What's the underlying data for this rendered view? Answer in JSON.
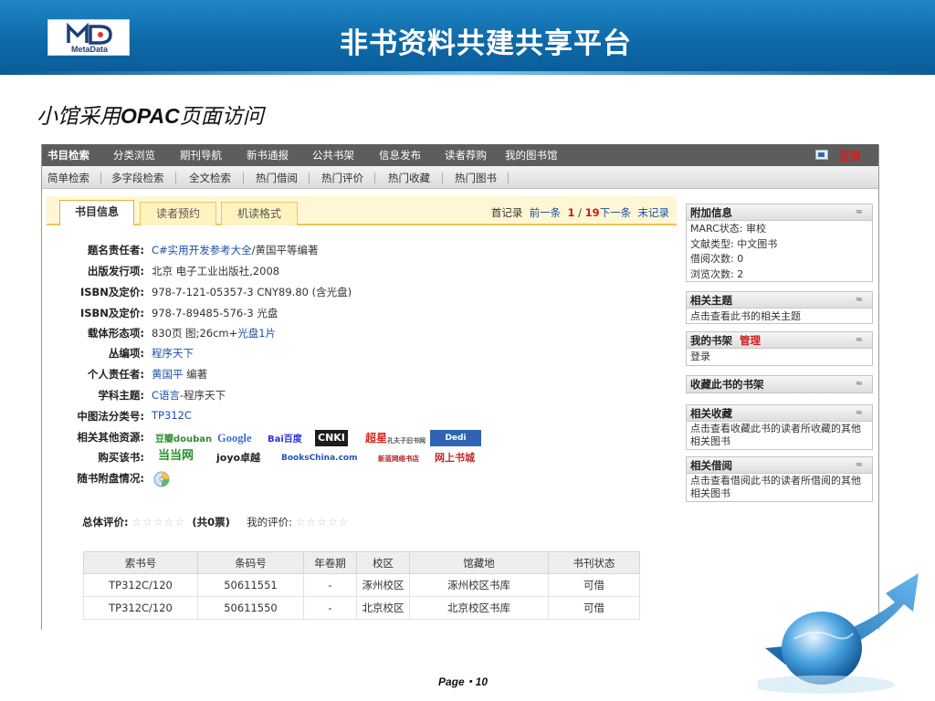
{
  "slide": {
    "title": "非书资料共建共享平台",
    "logo_text": "MetaData",
    "subtitle_pre": "小馆采用",
    "subtitle_bold": "OPAC",
    "subtitle_post": "页面访问",
    "page_label": "Page・10"
  },
  "nav_main": {
    "items": [
      "书目检索",
      "分类浏览",
      "期刊导航",
      "新书通报",
      "公共书架",
      "信息发布",
      "读者荐购",
      "我的图书馆"
    ],
    "login": "登录"
  },
  "nav_sub": {
    "items": [
      "简单检索",
      "多字段检索",
      "全文检索",
      "热门借阅",
      "热门评价",
      "热门收藏",
      "热门图书"
    ]
  },
  "tabs": [
    "书目信息",
    "读者预约",
    "机读格式"
  ],
  "pager": {
    "first": "首记录",
    "prev": "前一条",
    "current": "1",
    "separator": "/",
    "total": "19",
    "next": "下一条",
    "last": "末记录"
  },
  "fields": {
    "title_resp": {
      "label": "题名责任者:",
      "link": "C#实用开发参考大全",
      "rest": "/黄国平等编著"
    },
    "publisher": {
      "label": "出版发行项:",
      "value": "北京 电子工业出版社,2008"
    },
    "isbn1": {
      "label": "ISBN及定价:",
      "value": "978-7-121-05357-3 CNY89.80 (含光盘)"
    },
    "isbn2": {
      "label": "ISBN及定价:",
      "value": "978-7-89485-576-3 光盘"
    },
    "carrier": {
      "label": "载体形态项:",
      "pre": "830页 图;26cm+",
      "link": "光盘1片"
    },
    "series": {
      "label": "丛编项:",
      "link": "程序天下"
    },
    "person": {
      "label": "个人责任者:",
      "link": "黄国平",
      "rest": " 编著"
    },
    "subject": {
      "label": "学科主题:",
      "link": "C语言",
      "rest": "-程序天下"
    },
    "clc": {
      "label": "中图法分类号:",
      "link": "TP312C"
    },
    "related": {
      "label": "相关其他资源:",
      "logos": [
        "豆瓣douban",
        "Google",
        "Bai百度",
        "CNKI",
        "超星",
        "孔夫子旧书网",
        "Dedi"
      ]
    },
    "buy": {
      "label": "购买该书:",
      "logos": [
        "当当网",
        "joyo卓越",
        "BooksChina.com",
        "新蓝网络书店",
        "网上书城"
      ]
    },
    "disc": {
      "label": "随书附盘情况:"
    }
  },
  "rating": {
    "total_label": "总体评价:",
    "total_votes": "(共0票)",
    "mine_label": "我的评价:",
    "stars": "☆☆☆☆☆"
  },
  "holdings": {
    "headers": [
      "索书号",
      "条码号",
      "年卷期",
      "校区",
      "馆藏地",
      "书刊状态"
    ],
    "rows": [
      [
        "TP312C/120",
        "50611551",
        "-",
        "涿州校区",
        "涿州校区书库",
        "可借"
      ],
      [
        "TP312C/120",
        "50611550",
        "-",
        "北京校区",
        "北京校区书库",
        "可借"
      ]
    ]
  },
  "sidebar": {
    "extra": {
      "title": "附加信息",
      "lines": [
        "MARC状态: 审校",
        "文献类型: 中文图书",
        "借阅次数: 0",
        "浏览次数: 2"
      ]
    },
    "subject": {
      "title": "相关主题",
      "text": "点击查看此书的相关主题"
    },
    "shelf": {
      "title": "我的书架",
      "manage": "管理",
      "text": "登录"
    },
    "fav_shelf": {
      "title": "收藏此书的书架"
    },
    "related_fav": {
      "title": "相关收藏",
      "text": "点击查看收藏此书的读者所收藏的其他相关图书"
    },
    "related_borrow": {
      "title": "相关借阅",
      "text": "点击查看借阅此书的读者所借阅的其他相关图书"
    },
    "toggle": "≈"
  },
  "colors": {
    "header_blue": "#0f6aa9",
    "link_blue": "#1a4fa5",
    "alert_red": "#d01b1b",
    "tab_yellow": "#fff7d4"
  }
}
